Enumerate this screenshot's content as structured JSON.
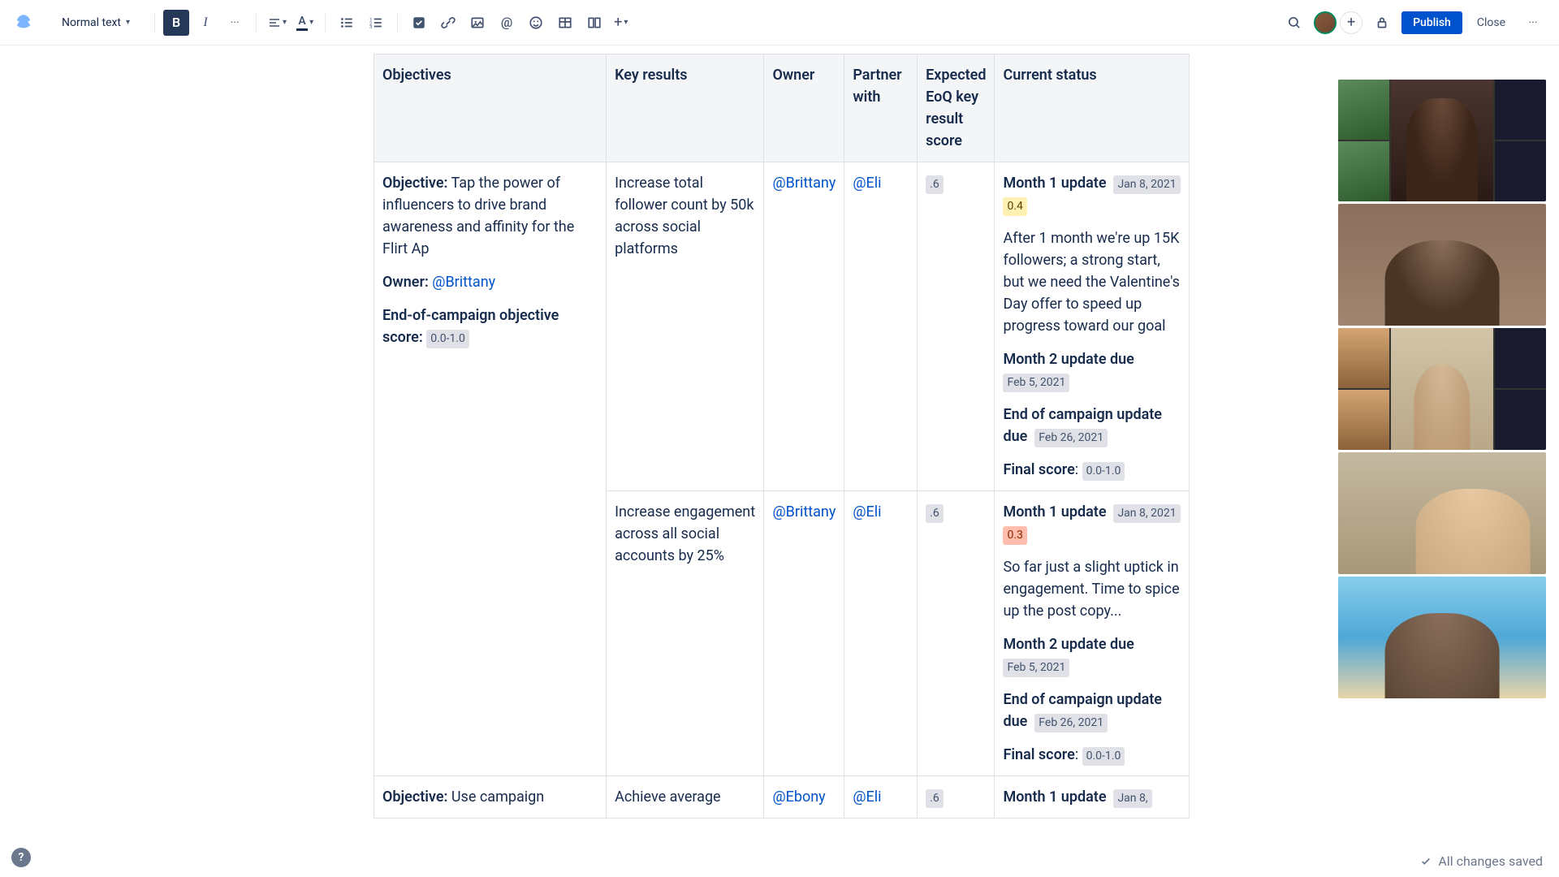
{
  "toolbar": {
    "text_style": "Normal text",
    "publish": "Publish",
    "close": "Close"
  },
  "table": {
    "headers": {
      "objectives": "Objectives",
      "key_results": "Key results",
      "owner": "Owner",
      "partner": "Partner with",
      "score": "Expected EoQ key result score",
      "status": "Current status"
    },
    "rows": [
      {
        "objective_label": "Objective:",
        "objective_text": " Tap the power of influencers to drive brand awareness and affinity for the Flirt Ap",
        "owner_label": "Owner:",
        "owner_mention": "@Brittany",
        "eoc_label": "End-of-campaign objective score:",
        "eoc_lozenge": "0.0-1.0",
        "key_result": "Increase total follower count by 50k across social platforms",
        "owner": "@Brittany",
        "partner": "@Eli",
        "score": ".6",
        "status": {
          "m1_label": "Month 1 update",
          "m1_date": "Jan 8, 2021",
          "m1_score": "0.4",
          "m1_text": "After 1 month we're up 15K followers; a strong start, but we need the Valentine's Day offer to speed up progress toward our goal",
          "m2_label": "Month 2 update due",
          "m2_date": "Feb 5, 2021",
          "eoc_label": "End of campaign update due",
          "eoc_date": "Feb 26, 2021",
          "final_label": "Final score",
          "final_lozenge": "0.0-1.0"
        }
      },
      {
        "key_result": "Increase engagement across all social accounts by 25%",
        "owner": "@Brittany",
        "partner": "@Eli",
        "score": ".6",
        "status": {
          "m1_label": "Month 1 update",
          "m1_date": "Jan 8, 2021",
          "m1_score": "0.3",
          "m1_text": "So far just a slight uptick in engagement. Time to spice up the post copy...",
          "m2_label": "Month 2 update due",
          "m2_date": "Feb 5, 2021",
          "eoc_label": "End of campaign update due",
          "eoc_date": "Feb 26, 2021",
          "final_label": "Final score",
          "final_lozenge": "0.0-1.0"
        }
      },
      {
        "objective_label": "Objective:",
        "objective_text": " Use campaign",
        "key_result": "Achieve average",
        "owner": "@Ebony",
        "partner": "@Eli",
        "score": ".6",
        "status": {
          "m1_label": "Month 1 update",
          "m1_date": "Jan 8,"
        }
      }
    ]
  },
  "footer": {
    "status": "All changes saved"
  }
}
